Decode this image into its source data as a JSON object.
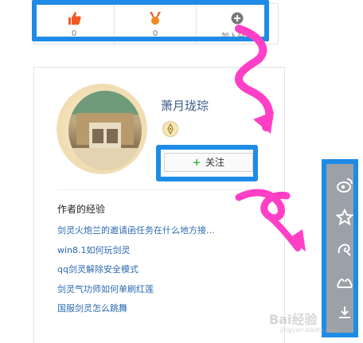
{
  "actions": [
    {
      "icon": "thumbs-up-icon",
      "label": "0"
    },
    {
      "icon": "medal-icon",
      "label": "0"
    },
    {
      "icon": "plus-circle-icon",
      "label": "加入杂志"
    }
  ],
  "author": {
    "name": "萧月珑琮",
    "follow_label": "关注",
    "follow_symbol": "+"
  },
  "experience": {
    "title": "作者的经验",
    "items": [
      "剑灵火炮兰的邀请函任务在什么地方接...",
      "win8.1如何玩剑灵",
      "qq剑灵解除安全模式",
      "剑灵气功师如何单刷红莲",
      "国服剑灵怎么跳舞"
    ]
  },
  "share_icons": [
    "weibo-icon",
    "star-icon",
    "swirl-icon",
    "people-icon",
    "share-download-icon"
  ],
  "colors": {
    "highlight": "#1e8be6",
    "arrow": "#ff3fc6",
    "link": "#2d6bb3",
    "like": "#ff5a1f"
  },
  "watermark": {
    "text": "Bai经验",
    "sub": "jingyan.baidu.com"
  }
}
